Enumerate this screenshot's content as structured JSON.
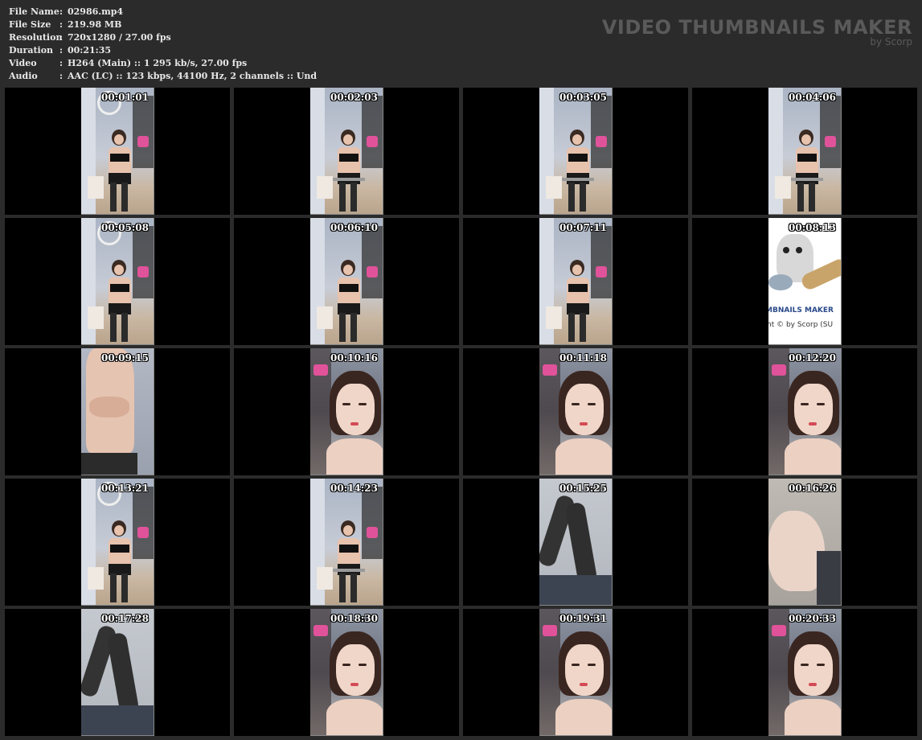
{
  "meta": [
    {
      "key": "File Name",
      "sep": ":",
      "value": "02986.mp4"
    },
    {
      "key": "File Size",
      "sep": ":",
      "value": "219.98 MB"
    },
    {
      "key": "Resolution",
      "sep": ":",
      "value": "720x1280 / 27.00 fps"
    },
    {
      "key": "Duration",
      "sep": ":",
      "value": "00:21:35"
    },
    {
      "key": "Video",
      "sep": ":",
      "value": "H264 (Main) :: 1 295 kb/s, 27.00 fps"
    },
    {
      "key": "Audio",
      "sep": ":",
      "value": "AAC (LC) :: 123 kbps, 44100 Hz, 2 channels :: Und"
    }
  ],
  "brand": {
    "title": "VIDEO THUMBNAILS MAKER",
    "subtitle": "by Scorp"
  },
  "thumbnails": [
    {
      "time": "00:01:01",
      "scene": "room-mirror"
    },
    {
      "time": "00:02:03",
      "scene": "room-chair"
    },
    {
      "time": "00:03:05",
      "scene": "room-chair"
    },
    {
      "time": "00:04:06",
      "scene": "room-chair"
    },
    {
      "time": "00:05:08",
      "scene": "room-mirror"
    },
    {
      "time": "00:06:10",
      "scene": "room-stand"
    },
    {
      "time": "00:07:11",
      "scene": "room-stand"
    },
    {
      "time": "00:08:13",
      "scene": "logo"
    },
    {
      "time": "00:09:15",
      "scene": "closeup-body"
    },
    {
      "time": "00:10:16",
      "scene": "closeup-face"
    },
    {
      "time": "00:11:18",
      "scene": "closeup-face"
    },
    {
      "time": "00:12:20",
      "scene": "closeup-face"
    },
    {
      "time": "00:13:21",
      "scene": "room-mirror"
    },
    {
      "time": "00:14:23",
      "scene": "room-chair"
    },
    {
      "time": "00:15:25",
      "scene": "closeup-legs"
    },
    {
      "time": "00:16:26",
      "scene": "closeup-hand"
    },
    {
      "time": "00:17:28",
      "scene": "closeup-legs"
    },
    {
      "time": "00:18:30",
      "scene": "closeup-face"
    },
    {
      "time": "00:19:31",
      "scene": "closeup-face"
    },
    {
      "time": "00:20:33",
      "scene": "closeup-face"
    }
  ],
  "logo_thumb": {
    "line1": "MBNAILS MAKER",
    "line2": "ht © by Scorp (SU"
  },
  "colors": {
    "background": "#2b2b2b",
    "cell": "#000000",
    "brand": "#5a5a5a"
  }
}
